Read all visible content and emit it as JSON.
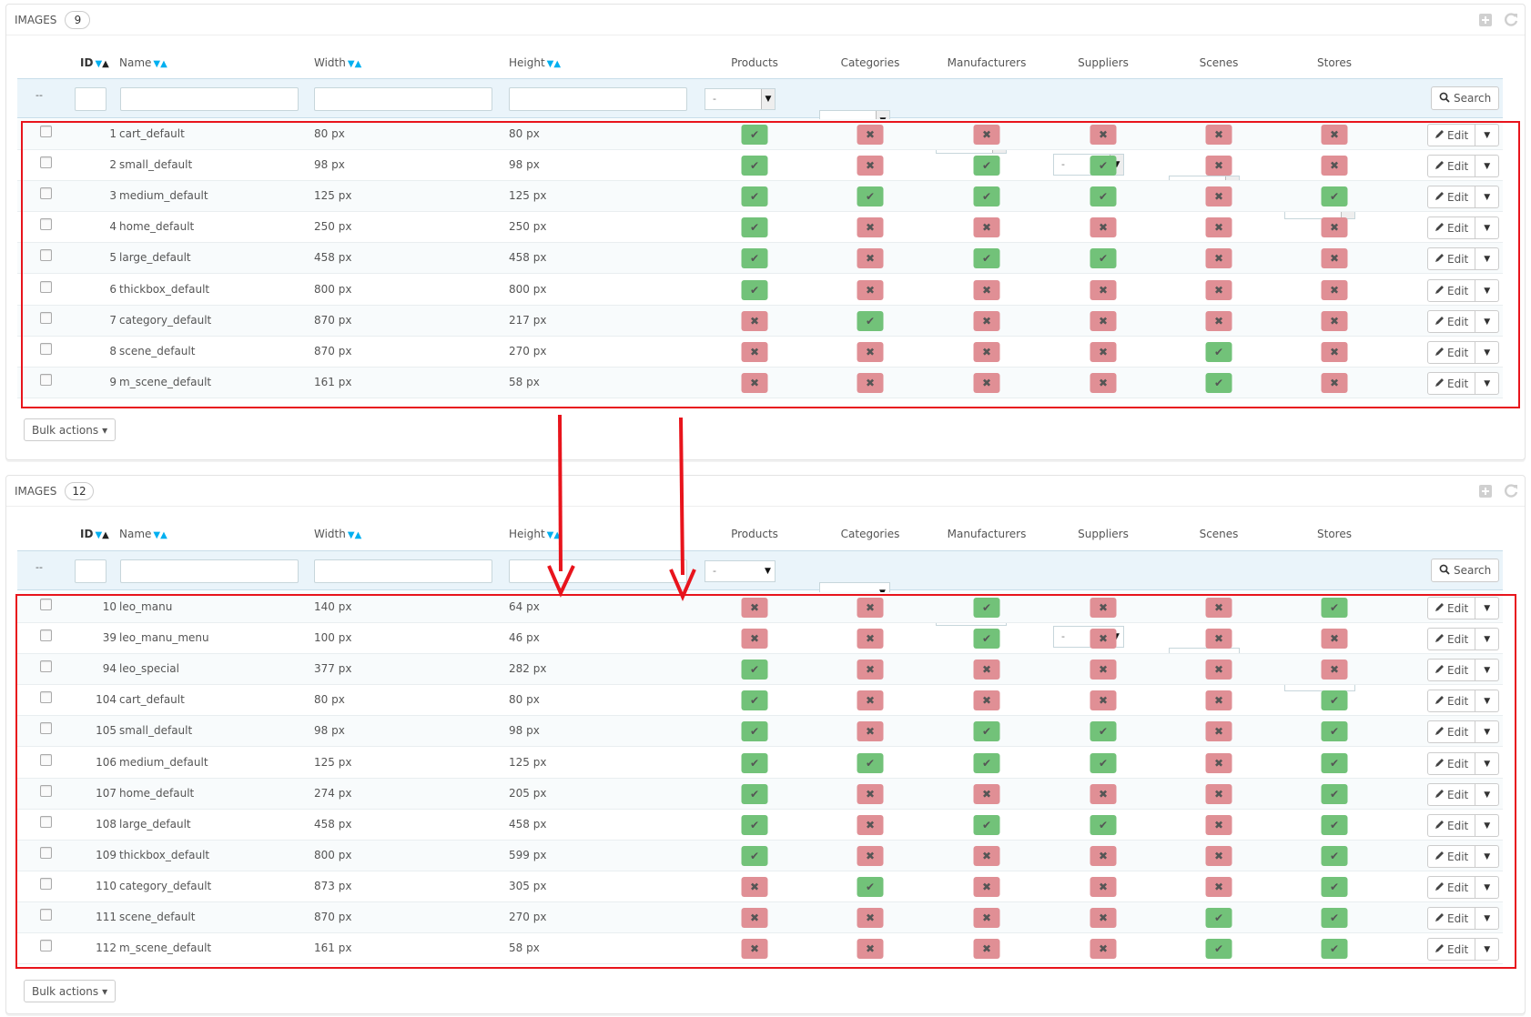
{
  "columns": {
    "id": "ID",
    "name": "Name",
    "width": "Width",
    "height": "Height",
    "products": "Products",
    "categories": "Categories",
    "manufacturers": "Manufacturers",
    "suppliers": "Suppliers",
    "scenes": "Scenes",
    "stores": "Stores"
  },
  "filter": {
    "dash": "--",
    "select_value": "-",
    "search_label": "Search"
  },
  "edit_label": "Edit",
  "bulk_label": "Bulk actions",
  "panels": [
    {
      "title": "IMAGES",
      "count": "9",
      "rows": [
        {
          "id": "1",
          "name": "cart_default",
          "width": "80 px",
          "height": "80 px",
          "flags": [
            true,
            false,
            false,
            false,
            false,
            false
          ]
        },
        {
          "id": "2",
          "name": "small_default",
          "width": "98 px",
          "height": "98 px",
          "flags": [
            true,
            false,
            true,
            true,
            false,
            false
          ]
        },
        {
          "id": "3",
          "name": "medium_default",
          "width": "125 px",
          "height": "125 px",
          "flags": [
            true,
            true,
            true,
            true,
            false,
            true
          ]
        },
        {
          "id": "4",
          "name": "home_default",
          "width": "250 px",
          "height": "250 px",
          "flags": [
            true,
            false,
            false,
            false,
            false,
            false
          ]
        },
        {
          "id": "5",
          "name": "large_default",
          "width": "458 px",
          "height": "458 px",
          "flags": [
            true,
            false,
            true,
            true,
            false,
            false
          ]
        },
        {
          "id": "6",
          "name": "thickbox_default",
          "width": "800 px",
          "height": "800 px",
          "flags": [
            true,
            false,
            false,
            false,
            false,
            false
          ]
        },
        {
          "id": "7",
          "name": "category_default",
          "width": "870 px",
          "height": "217 px",
          "flags": [
            false,
            true,
            false,
            false,
            false,
            false
          ]
        },
        {
          "id": "8",
          "name": "scene_default",
          "width": "870 px",
          "height": "270 px",
          "flags": [
            false,
            false,
            false,
            false,
            true,
            false
          ]
        },
        {
          "id": "9",
          "name": "m_scene_default",
          "width": "161 px",
          "height": "58 px",
          "flags": [
            false,
            false,
            false,
            false,
            true,
            false
          ]
        }
      ]
    },
    {
      "title": "IMAGES",
      "count": "12",
      "rows": [
        {
          "id": "10",
          "name": "leo_manu",
          "width": "140 px",
          "height": "64 px",
          "flags": [
            false,
            false,
            true,
            false,
            false,
            true
          ]
        },
        {
          "id": "39",
          "name": "leo_manu_menu",
          "width": "100 px",
          "height": "46 px",
          "flags": [
            false,
            false,
            true,
            false,
            false,
            false
          ]
        },
        {
          "id": "94",
          "name": "leo_special",
          "width": "377 px",
          "height": "282 px",
          "flags": [
            true,
            false,
            false,
            false,
            false,
            false
          ]
        },
        {
          "id": "104",
          "name": "cart_default",
          "width": "80 px",
          "height": "80 px",
          "flags": [
            true,
            false,
            false,
            false,
            false,
            true
          ]
        },
        {
          "id": "105",
          "name": "small_default",
          "width": "98 px",
          "height": "98 px",
          "flags": [
            true,
            false,
            true,
            true,
            false,
            true
          ]
        },
        {
          "id": "106",
          "name": "medium_default",
          "width": "125 px",
          "height": "125 px",
          "flags": [
            true,
            true,
            true,
            true,
            false,
            true
          ]
        },
        {
          "id": "107",
          "name": "home_default",
          "width": "274 px",
          "height": "205 px",
          "flags": [
            true,
            false,
            false,
            false,
            false,
            true
          ]
        },
        {
          "id": "108",
          "name": "large_default",
          "width": "458 px",
          "height": "458 px",
          "flags": [
            true,
            false,
            true,
            true,
            false,
            true
          ]
        },
        {
          "id": "109",
          "name": "thickbox_default",
          "width": "800 px",
          "height": "599 px",
          "flags": [
            true,
            false,
            false,
            false,
            false,
            true
          ]
        },
        {
          "id": "110",
          "name": "category_default",
          "width": "873 px",
          "height": "305 px",
          "flags": [
            false,
            true,
            false,
            false,
            false,
            true
          ]
        },
        {
          "id": "111",
          "name": "scene_default",
          "width": "870 px",
          "height": "270 px",
          "flags": [
            false,
            false,
            false,
            false,
            true,
            true
          ]
        },
        {
          "id": "112",
          "name": "m_scene_default",
          "width": "161 px",
          "height": "58 px",
          "flags": [
            false,
            false,
            false,
            false,
            true,
            true
          ]
        }
      ]
    }
  ],
  "colors": {
    "yes": "#72c279",
    "no": "#e08f95",
    "annotation": "#e8141c",
    "filter_bg": "#eaf4fa",
    "sort_accent": "#00aff0"
  },
  "icons": {
    "add": "plus-square-icon",
    "refresh": "refresh-icon",
    "search": "search-icon",
    "edit": "pencil-icon",
    "yes": "check-icon",
    "no": "cross-icon"
  }
}
